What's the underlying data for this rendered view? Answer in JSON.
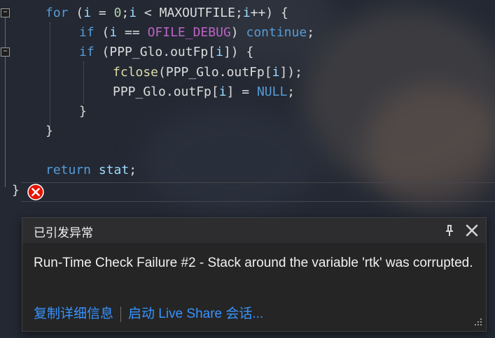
{
  "code": {
    "lines": [
      [
        "for",
        " (",
        "i",
        " = ",
        "0",
        ";",
        "i",
        " < ",
        "MAXOUTFILE",
        ";",
        "i",
        "++) {"
      ],
      [
        "if",
        " (",
        "i",
        " == ",
        "OFILE_DEBUG",
        ") ",
        "continue",
        ";"
      ],
      [
        "if",
        " (",
        "PPP_Glo",
        ".",
        "outFp",
        "[",
        "i",
        "]) {"
      ],
      [
        "fclose",
        "(",
        "PPP_Glo",
        ".",
        "outFp",
        "[",
        "i",
        "]);"
      ],
      [
        "PPP_Glo",
        ".",
        "outFp",
        "[",
        "i",
        "] = ",
        "NULL",
        ";"
      ],
      [
        "}"
      ],
      [
        "}"
      ],
      [
        "return",
        " ",
        "stat",
        ";"
      ],
      [
        "}"
      ]
    ]
  },
  "popup": {
    "title": "已引发异常",
    "message": "Run-Time Check Failure #2 - Stack around the variable 'rtk' was corrupted.",
    "link_details": "复制详细信息",
    "link_liveshare": "启动 Live Share 会话..."
  },
  "icons": {
    "error": "error-circle-icon",
    "pin": "pin-icon",
    "close": "close-icon",
    "resize": "resize-grip-icon"
  },
  "colors": {
    "keyword": "#569cd6",
    "identifier": "#9cdcfe",
    "number": "#b5cea8",
    "macro": "#bd63c5",
    "function": "#dcdcaa",
    "link": "#3794ff",
    "error": "#e51400"
  }
}
